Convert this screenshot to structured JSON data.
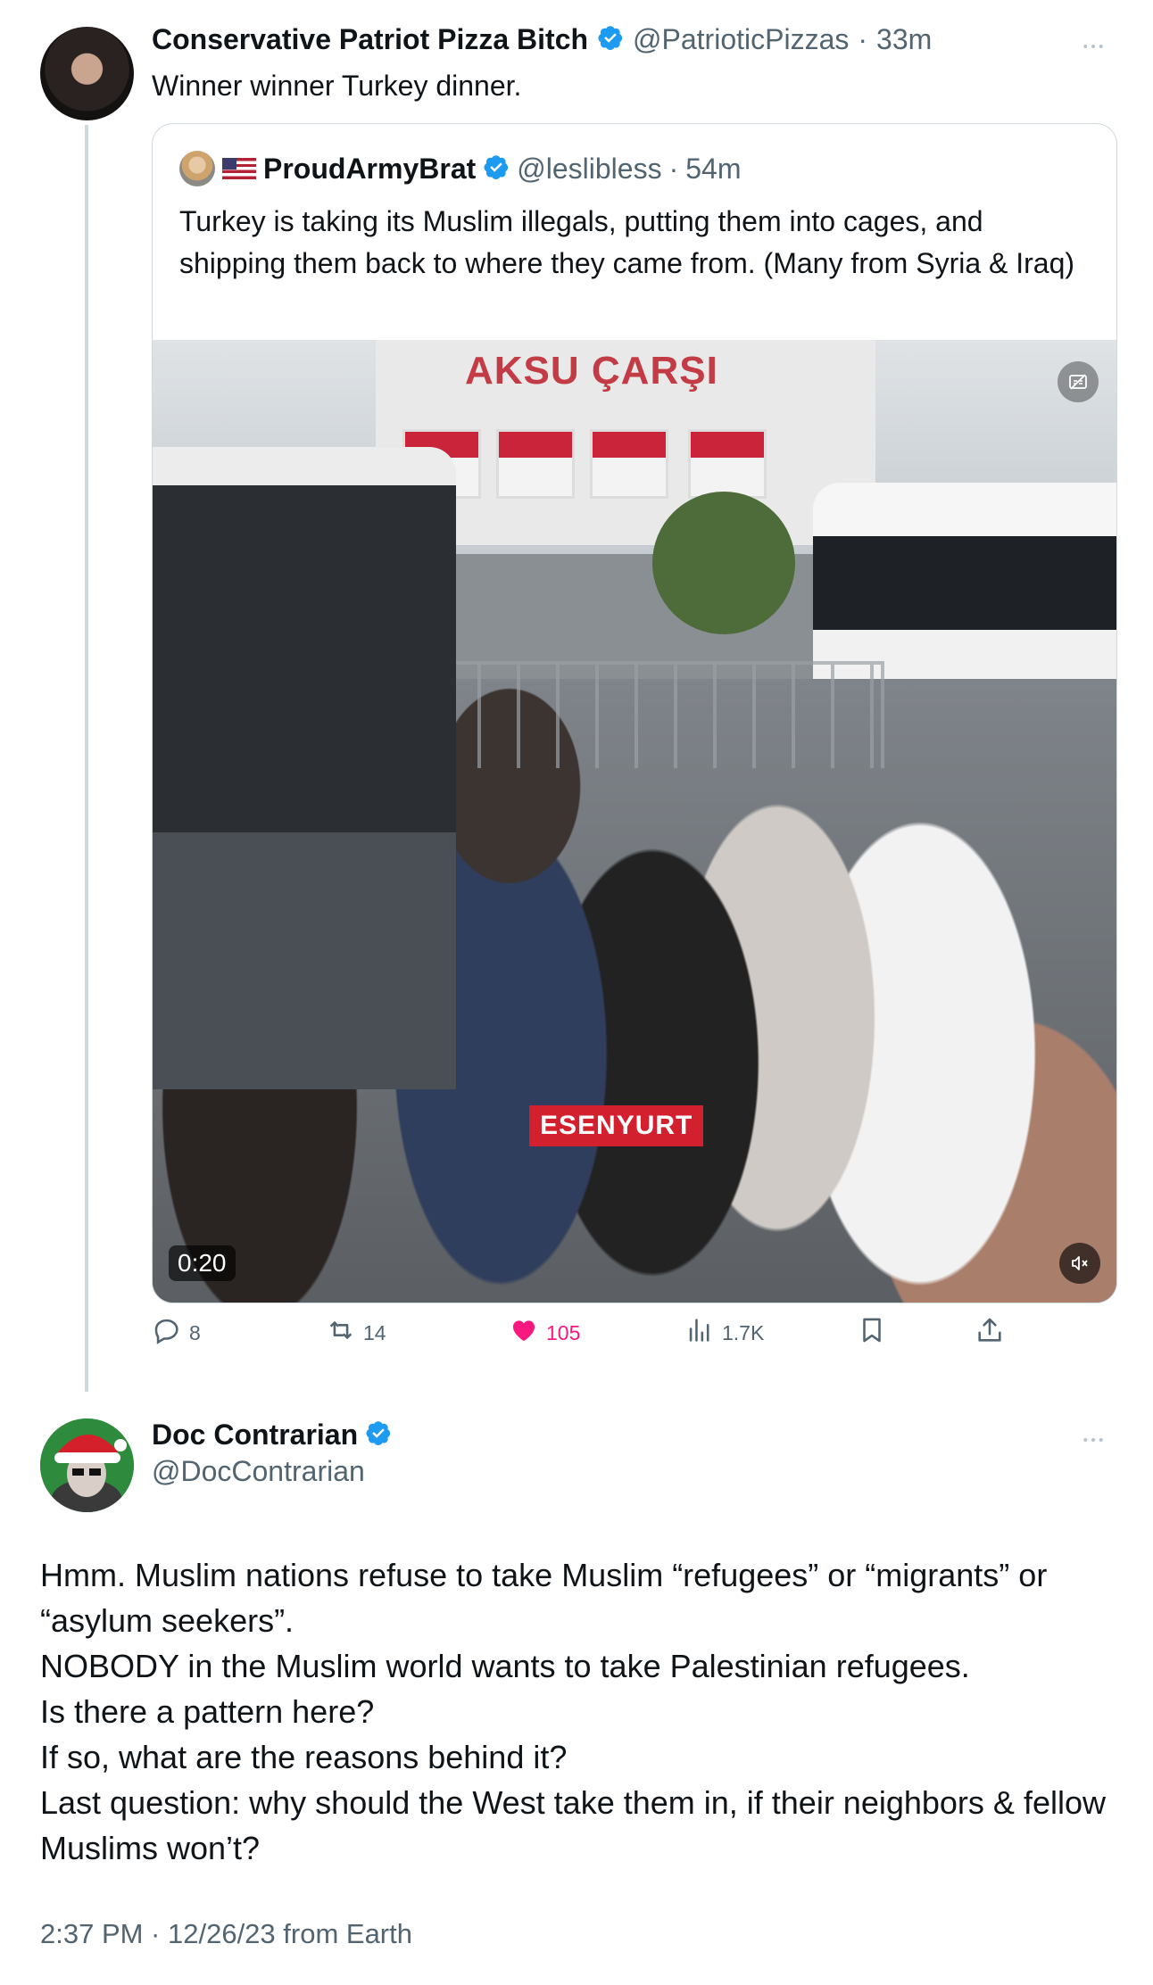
{
  "tweet": {
    "author_name": "Conservative Patriot Pizza Bitch",
    "handle": "@PatrioticPizzas",
    "separator": "·",
    "time": "33m",
    "text": "Winner winner Turkey dinner."
  },
  "quoted_tweet": {
    "author_name": "ProudArmyBrat",
    "handle": "@leslibless",
    "separator": "·",
    "time": "54m",
    "text": "Turkey is taking its Muslim illegals, putting them into cages, and shipping them back to where they came from. (Many from Syria & Iraq)",
    "media": {
      "sign_text": "AKSU ÇARŞI",
      "overlay_label": "ESENYURT",
      "duration": "0:20"
    }
  },
  "actions": {
    "reply_count": "8",
    "retweet_count": "14",
    "like_count": "105",
    "view_count": "1.7K",
    "like_color": "#f91880"
  },
  "reply": {
    "author_name": "Doc Contrarian",
    "handle": "@DocContrarian",
    "lines": [
      "Hmm. Muslim nations refuse to take Muslim “refugees” or “migrants” or “asylum seekers”.",
      "NOBODY in the Muslim world wants to take Palestinian refugees.",
      "Is there a pattern here?",
      "If so, what are the reasons behind it?",
      "Last question: why should the West take them in, if their neighbors & fellow Muslims won’t?"
    ],
    "timestamp": "2:37 PM · 12/26/23 from Earth"
  },
  "colors": {
    "verified_blue": "#1d9bf0",
    "text_primary": "#0f1419",
    "text_secondary": "#536471",
    "border": "#cfd9de"
  },
  "icons": [
    "verified-badge-icon",
    "more-icon",
    "reply-icon",
    "retweet-icon",
    "heart-icon",
    "views-icon",
    "bookmark-icon",
    "share-icon",
    "mute-icon",
    "captions-icon"
  ]
}
